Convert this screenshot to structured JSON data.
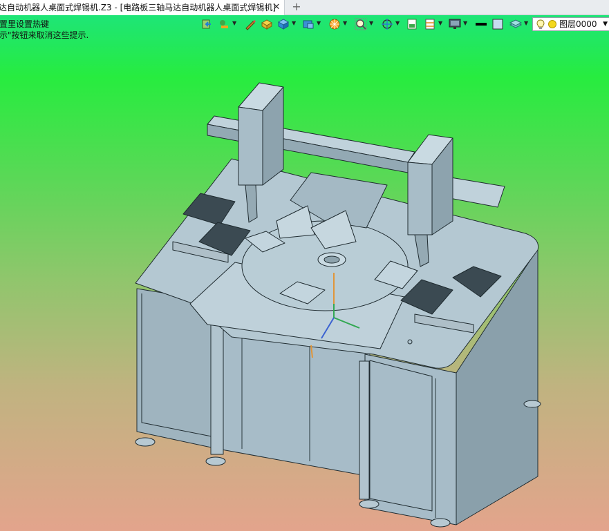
{
  "tab": {
    "title": "达自动机器人桌面式焊锡机.Z3 - [电路板三轴马达自动机器人桌面式焊锡机]",
    "close_glyph": "✕",
    "new_tab_glyph": "+"
  },
  "viewport": {
    "hint_line1": "置里设置热键",
    "hint_line2": "示\"按钮来取消这些提示."
  },
  "toolbar": {
    "layer_name": "图层0000",
    "icons": [
      "exit-icon",
      "snap-icon",
      "pen-icon",
      "box-icon",
      "cube-icon",
      "part-icon",
      "render-icon",
      "zoom-icon",
      "rotate-icon",
      "view-icon",
      "layout-icon",
      "monitor-icon",
      "line-color-icon",
      "fill-color-icon",
      "layer-stack-icon"
    ],
    "colors": {
      "accent": "#1e7fd6",
      "orange": "#f2a51f",
      "line": "#000000",
      "fill": "#c7dcef"
    }
  },
  "model": {
    "colors": {
      "body": "#a7bcc8",
      "top": "#b4c8d2",
      "dark": "#7f959f",
      "edge": "#1f2b30",
      "x_axis": "#32a852",
      "y_axis": "#3b62d1",
      "z_axis": "#e0963a"
    }
  }
}
